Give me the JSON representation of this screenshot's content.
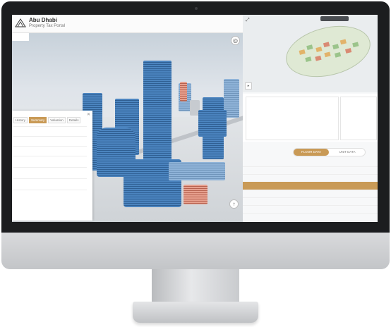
{
  "app": {
    "brand_name": "Abu Dhabi",
    "brand_subtitle": "Property Tax Portal"
  },
  "map": {
    "breadcrumb": "",
    "compass_icon": "compass-icon",
    "north_icon": "north-arrow-icon",
    "attribution": "",
    "buildings": [
      {
        "type": "tower-main"
      },
      {
        "type": "tower-left"
      },
      {
        "type": "tower-mid"
      },
      {
        "type": "podium"
      },
      {
        "type": "roof-red"
      },
      {
        "type": "tower-far"
      }
    ]
  },
  "info_panel": {
    "tabs": [
      "History",
      "Summary",
      "Valuation",
      "Details"
    ],
    "active_tab": "Summary",
    "fields": [
      {
        "label": "",
        "value": ""
      },
      {
        "label": "",
        "value": ""
      },
      {
        "label": "",
        "value": ""
      }
    ],
    "footer_hint": "",
    "footer_note": ""
  },
  "summary": {
    "card_left": {
      "title": "",
      "subtitle": "",
      "headers": [
        "",
        "",
        "",
        ""
      ],
      "rows": [
        [
          "",
          "",
          "",
          ""
        ],
        [
          "",
          "",
          "",
          ""
        ]
      ]
    },
    "card_right": {
      "lines": [
        "",
        "",
        "",
        ""
      ]
    }
  },
  "floor_toggle": {
    "options": [
      "FLOOR DATA",
      "UNIT DATA"
    ],
    "selected": "FLOOR DATA"
  },
  "floor_table": {
    "selected_index": 3,
    "rows": [
      [
        "",
        "",
        "",
        ""
      ],
      [
        "",
        "",
        "",
        ""
      ],
      [
        "",
        "",
        "",
        ""
      ],
      [
        "",
        "",
        "",
        ""
      ],
      [
        "",
        "",
        "",
        ""
      ],
      [
        "",
        "",
        "",
        ""
      ],
      [
        "",
        "",
        "",
        ""
      ],
      [
        "",
        "",
        "",
        ""
      ]
    ]
  },
  "colors": {
    "accent": "#c99a56",
    "building_blue": "#3a6fa8",
    "bezel": "#1c1d1f"
  }
}
